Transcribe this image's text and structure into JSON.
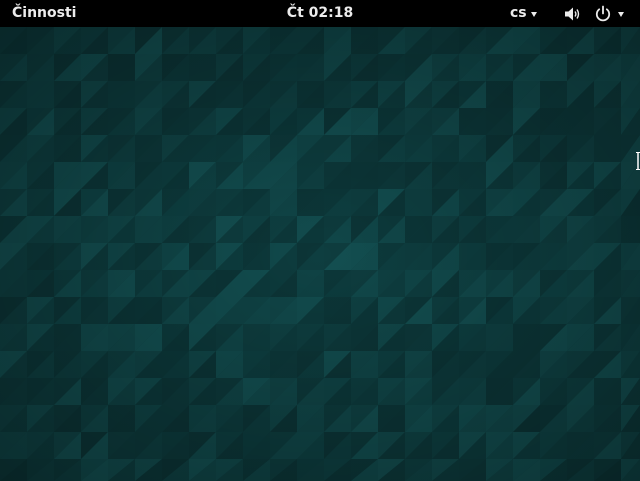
{
  "topbar": {
    "activities_label": "Činnosti",
    "clock": "Čt 02:18",
    "keyboard_layout": "cs",
    "volume_icon": "speaker-volume-icon",
    "power_icon": "power-icon",
    "menu_arrow_icon": "triangle-down-icon"
  },
  "desktop": {
    "wallpaper": "teal-triangle-mosaic",
    "colors": {
      "base": "#0e3f41",
      "light": "#135052",
      "dark": "#0a2e30",
      "topbar": "#000000",
      "text": "#ececec"
    }
  }
}
